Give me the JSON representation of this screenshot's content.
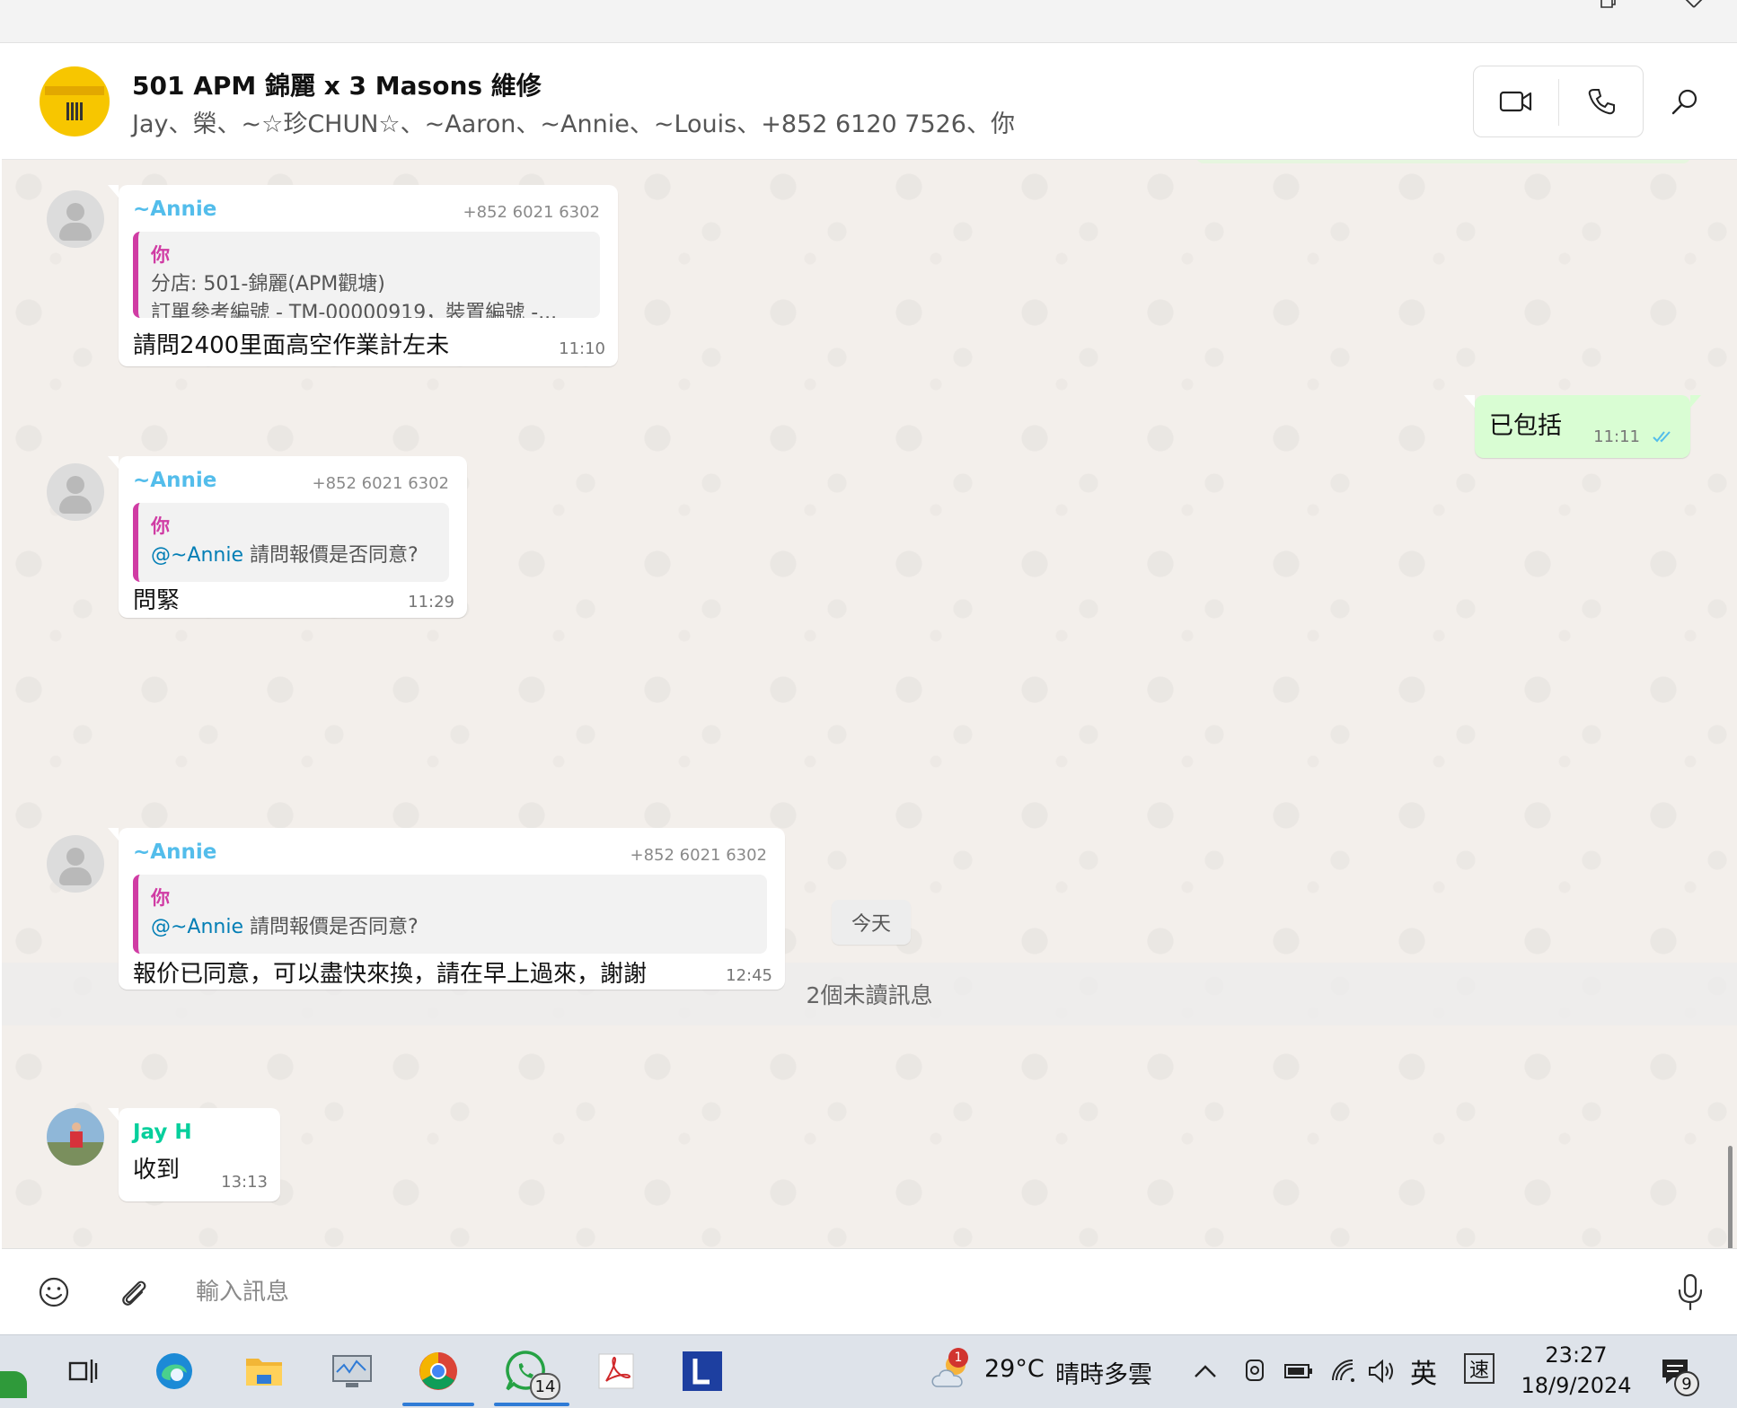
{
  "colors": {
    "accent_green": "#25d366",
    "outgoing_bubble": "#d9fdd3",
    "sender_annie": "#53bdeb",
    "sender_jay": "#06cf9c",
    "quote_bar": "#d03ca4",
    "tick_read": "#53bdeb"
  },
  "header": {
    "title": "501 APM 錦麗 x 3 Masons 維修",
    "members": "Jay、榮、~☆珍CHUN☆、~Aaron、~Annie、~Louis、+852 6120 7526、你",
    "video_icon": "video-camera-icon",
    "call_icon": "phone-icon",
    "search_icon": "search-icon"
  },
  "messages": [
    {
      "sender": "~Annie",
      "phone": "+852 6021 6302",
      "quote": {
        "author": "你",
        "line1": "分店: 501-錦麗(APM觀塘)",
        "line2": "訂單參考編號 - TM-00000919，裝置編號 -..."
      },
      "text": "請問2400里面高空作業計左未",
      "time": "11:10"
    },
    {
      "outgoing": true,
      "text": "已包括",
      "time": "11:11",
      "status_icon": "double-check-icon"
    },
    {
      "sender": "~Annie",
      "phone": "+852 6021 6302",
      "quote": {
        "author": "你",
        "mention": "@~Annie",
        "rest": " 請問報價是否同意?"
      },
      "text": "問緊",
      "time": "11:29"
    },
    {
      "sender": "~Annie",
      "phone": "+852 6021 6302",
      "quote": {
        "author": "你",
        "mention": "@~Annie",
        "rest": " 請問報價是否同意?"
      },
      "text": "報价已同意，可以盡快來換，請在早上過來，謝謝",
      "time": "12:45"
    },
    {
      "sender": "Jay H",
      "text": "收到",
      "time": "13:13"
    }
  ],
  "date_divider": "今天",
  "unread_banner": "2個未讀訊息",
  "composer": {
    "placeholder": "輸入訊息",
    "emoji_icon": "emoji-icon",
    "attach_icon": "paperclip-icon",
    "mic_icon": "microphone-icon"
  },
  "taskbar": {
    "apps": [
      "task-view-icon",
      "edge-icon",
      "file-explorer-icon",
      "monitor-app-icon",
      "chrome-icon",
      "whatsapp-icon",
      "acrobat-icon",
      "l-app-icon"
    ],
    "whatsapp_badge": "14",
    "weather_badge": "1",
    "weather_temp": "29°C",
    "weather_desc": "晴時多雲",
    "ime": "英",
    "speed_mode": "速",
    "time": "23:27",
    "date": "18/9/2024",
    "notifications": "9"
  }
}
